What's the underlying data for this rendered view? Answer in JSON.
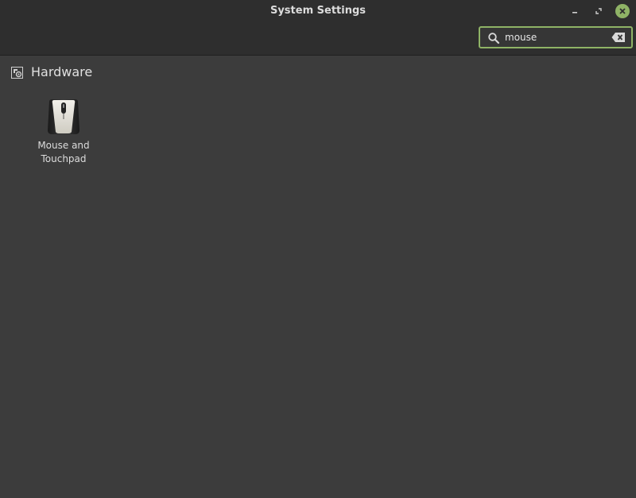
{
  "window": {
    "title": "System Settings"
  },
  "search": {
    "value": "mouse",
    "placeholder": ""
  },
  "category": {
    "title": "Hardware",
    "icon": "hardware-category-icon"
  },
  "applets": [
    {
      "label_line1": "Mouse and",
      "label_line2": "Touchpad",
      "icon": "mouse-icon"
    }
  ],
  "colors": {
    "accent": "#8fb366",
    "titlebar": "#2e2e2e",
    "background": "#3c3c3c",
    "text": "#dcdcdc"
  }
}
